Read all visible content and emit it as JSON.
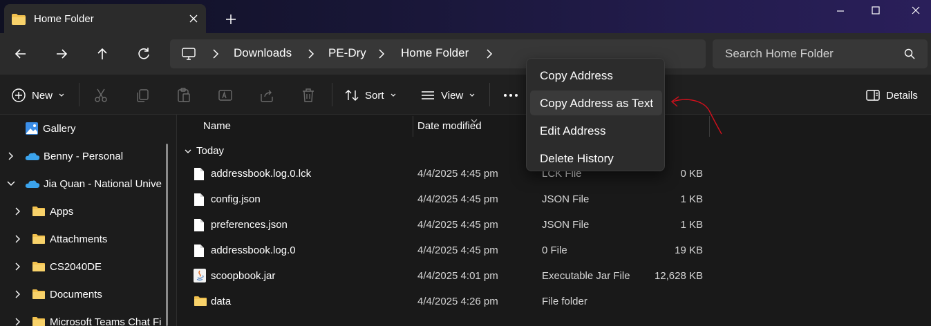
{
  "tab": {
    "title": "Home Folder"
  },
  "address": {
    "crumbs": [
      "Downloads",
      "PE-Dry",
      "Home Folder"
    ]
  },
  "search": {
    "placeholder": "Search Home Folder"
  },
  "commands": {
    "new_label": "New",
    "sort_label": "Sort",
    "view_label": "View",
    "details_label": "Details"
  },
  "sidebar": {
    "items": [
      {
        "label": "Gallery",
        "icon": "gallery-icon"
      },
      {
        "label": "Benny - Personal",
        "icon": "onedrive-icon"
      },
      {
        "label": "Jia Quan - National Unive",
        "icon": "onedrive-icon"
      },
      {
        "label": "Apps",
        "icon": "folder-icon"
      },
      {
        "label": "Attachments",
        "icon": "folder-icon"
      },
      {
        "label": "CS2040DE",
        "icon": "folder-icon"
      },
      {
        "label": "Documents",
        "icon": "folder-icon"
      },
      {
        "label": "Microsoft Teams Chat Fi",
        "icon": "folder-icon"
      }
    ]
  },
  "columns": {
    "name": "Name",
    "date": "Date modified"
  },
  "group": {
    "label": "Today"
  },
  "files": [
    {
      "name": "addressbook.log.0.lck",
      "date": "4/4/2025 4:45 pm",
      "type": "LCK File",
      "size": "0 KB",
      "icon": "file-icon"
    },
    {
      "name": "config.json",
      "date": "4/4/2025 4:45 pm",
      "type": "JSON File",
      "size": "1 KB",
      "icon": "file-icon"
    },
    {
      "name": "preferences.json",
      "date": "4/4/2025 4:45 pm",
      "type": "JSON File",
      "size": "1 KB",
      "icon": "file-icon"
    },
    {
      "name": "addressbook.log.0",
      "date": "4/4/2025 4:45 pm",
      "type": "0 File",
      "size": "19 KB",
      "icon": "file-icon"
    },
    {
      "name": "scoopbook.jar",
      "date": "4/4/2025 4:01 pm",
      "type": "Executable Jar File",
      "size": "12,628 KB",
      "icon": "java-icon"
    },
    {
      "name": "data",
      "date": "4/4/2025 4:26 pm",
      "type": "File folder",
      "size": "",
      "icon": "folder-icon"
    }
  ],
  "context_menu": {
    "items": [
      "Copy Address",
      "Copy Address as Text",
      "Edit Address",
      "Delete History"
    ],
    "highlighted": "Copy Address as Text"
  },
  "colors": {
    "folder": "#f2c14e",
    "annotation": "#d0101c",
    "accent": "#4cc2ff"
  }
}
